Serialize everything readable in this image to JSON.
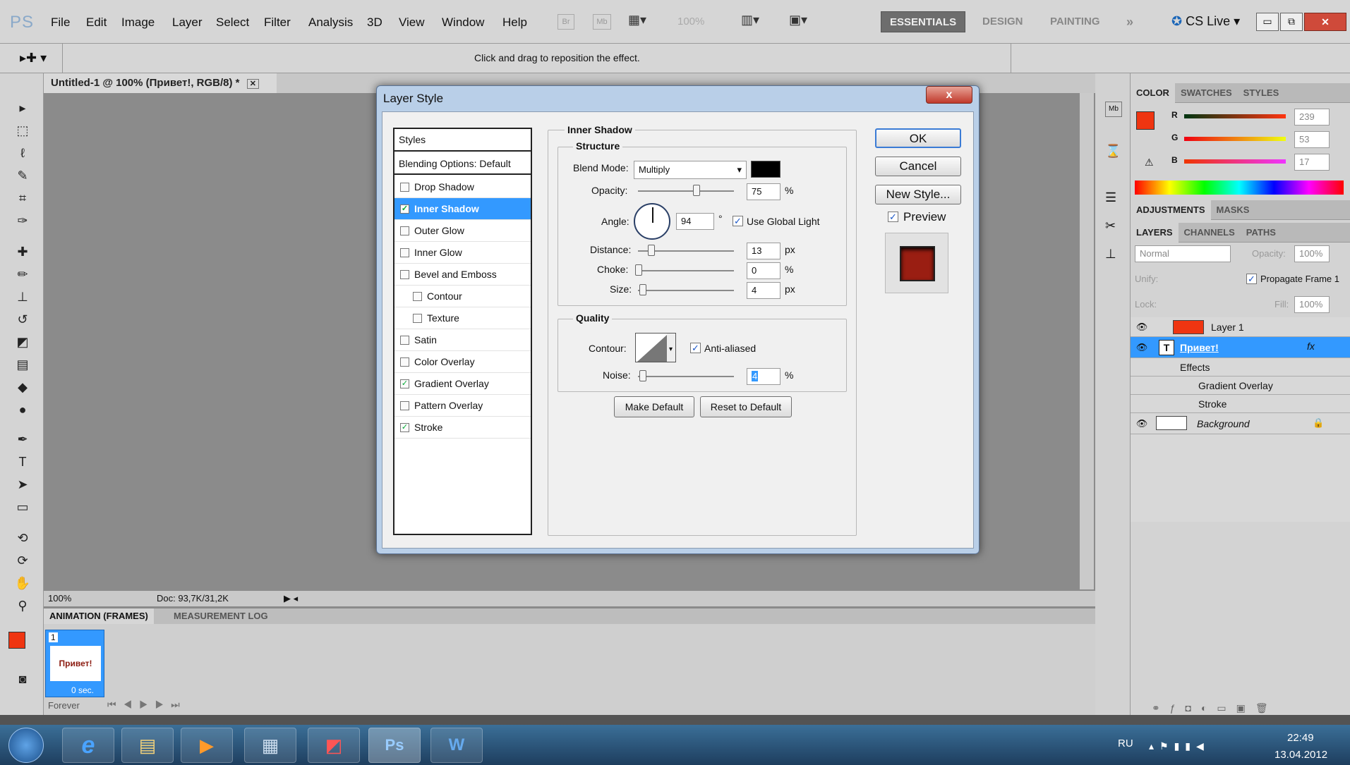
{
  "app": {
    "logo": "PS",
    "menus": [
      "File",
      "Edit",
      "Image",
      "Layer",
      "Select",
      "Filter",
      "Analysis",
      "3D",
      "View",
      "Window",
      "Help"
    ],
    "bridge": "Br",
    "mini": "Mb",
    "zoom": "100%",
    "workspaces": [
      "ESSENTIALS",
      "DESIGN",
      "PAINTING"
    ],
    "more": "»",
    "cs_live": "CS Live"
  },
  "options": {
    "hint": "Click and drag to reposition the effect."
  },
  "document": {
    "tab": "Untitled-1 @ 100% (Привет!, RGB/8) *",
    "zoom": "100%",
    "doc": "Doc: 93,7K/31,2K"
  },
  "animation": {
    "tabs": [
      "ANIMATION (FRAMES)",
      "MEASUREMENT LOG"
    ],
    "frame_number": "1",
    "frame_text": "Привет!",
    "frame_delay": "0 sec.",
    "loop": "Forever"
  },
  "dialog": {
    "title": "Layer Style",
    "close": "x",
    "styles_header": "Styles",
    "blending": "Blending Options: Default",
    "style_items": [
      {
        "label": "Drop Shadow",
        "checked": false,
        "selected": false,
        "sub": false
      },
      {
        "label": "Inner Shadow",
        "checked": true,
        "selected": true,
        "sub": false
      },
      {
        "label": "Outer Glow",
        "checked": false,
        "selected": false,
        "sub": false
      },
      {
        "label": "Inner Glow",
        "checked": false,
        "selected": false,
        "sub": false
      },
      {
        "label": "Bevel and Emboss",
        "checked": false,
        "selected": false,
        "sub": false
      },
      {
        "label": "Contour",
        "checked": false,
        "selected": false,
        "sub": true
      },
      {
        "label": "Texture",
        "checked": false,
        "selected": false,
        "sub": true
      },
      {
        "label": "Satin",
        "checked": false,
        "selected": false,
        "sub": false
      },
      {
        "label": "Color Overlay",
        "checked": false,
        "selected": false,
        "sub": false
      },
      {
        "label": "Gradient Overlay",
        "checked": true,
        "selected": false,
        "sub": false
      },
      {
        "label": "Pattern Overlay",
        "checked": false,
        "selected": false,
        "sub": false
      },
      {
        "label": "Stroke",
        "checked": true,
        "selected": false,
        "sub": false
      }
    ],
    "section": "Inner Shadow",
    "structure": "Structure",
    "blend_mode_label": "Blend Mode:",
    "blend_mode": "Multiply",
    "blend_color": "#000000",
    "opacity_label": "Opacity:",
    "opacity": "75",
    "opacity_unit": "%",
    "opacity_fraction": 0.75,
    "angle_label": "Angle:",
    "angle": "94",
    "angle_unit": "°",
    "global_light": "Use Global Light",
    "distance_label": "Distance:",
    "distance": "13",
    "distance_unit": "px",
    "choke_label": "Choke:",
    "choke": "0",
    "choke_unit": "%",
    "size_label": "Size:",
    "size": "4",
    "size_unit": "px",
    "quality": "Quality",
    "contour_label": "Contour:",
    "anti_aliased": "Anti-aliased",
    "noise_label": "Noise:",
    "noise": "4",
    "noise_unit": "%",
    "make_default": "Make Default",
    "reset_default": "Reset to Default",
    "ok": "OK",
    "cancel": "Cancel",
    "new_style": "New Style...",
    "preview": "Preview"
  },
  "color_panel": {
    "tabs": [
      "COLOR",
      "SWATCHES",
      "STYLES"
    ],
    "r_label": "R",
    "g_label": "G",
    "b_label": "B",
    "r": "239",
    "g": "53",
    "b": "17",
    "fg": "#ef3511"
  },
  "adjust_tabs": [
    "ADJUSTMENTS",
    "MASKS"
  ],
  "layers_panel": {
    "tabs": [
      "LAYERS",
      "CHANNELS",
      "PATHS"
    ],
    "mode": "Normal",
    "opacity_label": "Opacity:",
    "opacity": "100%",
    "unify": "Unify:",
    "propagate": "Propagate Frame 1",
    "lock": "Lock:",
    "fill_label": "Fill:",
    "fill": "100%",
    "layers": [
      {
        "name": "Layer 1"
      },
      {
        "name": "Привет!",
        "fx": "fx"
      },
      {
        "name": "Effects"
      },
      {
        "name": "Gradient Overlay"
      },
      {
        "name": "Stroke"
      },
      {
        "name": "Background"
      }
    ]
  },
  "taskbar": {
    "lang": "RU",
    "time": "22:49",
    "date": "13.04.2012"
  }
}
